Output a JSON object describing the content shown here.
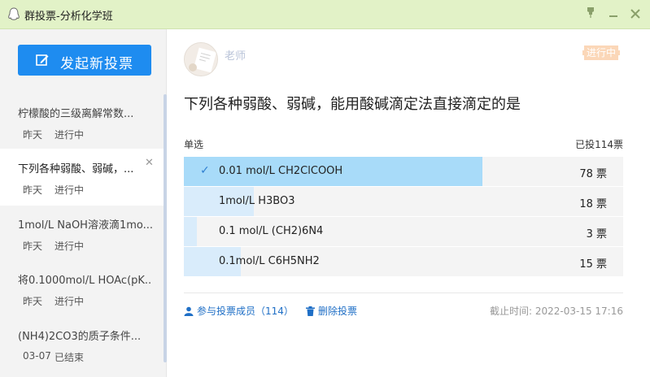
{
  "window": {
    "title": "群投票-分析化学班",
    "buttons": {
      "pin": "pin-icon",
      "minimize": "minimize-icon",
      "close": "close-icon"
    }
  },
  "sidebar": {
    "new_vote_label": "发起新投票",
    "items": [
      {
        "title": "柠檬酸的三级离解常数...",
        "date": "昨天",
        "status": "进行中"
      },
      {
        "title": "下列各种弱酸、弱碱，...",
        "date": "昨天",
        "status": "进行中"
      },
      {
        "title": "1mol/L NaOH溶液滴1mo...",
        "date": "昨天",
        "status": "进行中"
      },
      {
        "title": "将0.1000mol/L HOAc(pK...",
        "date": "昨天",
        "status": "进行中"
      },
      {
        "title": "(NH4)2CO3的质子条件...",
        "date": "03-07",
        "status": "已结束"
      }
    ]
  },
  "main": {
    "author": "老师",
    "status_tag": "进行中",
    "question": "下列各种弱酸、弱碱，能用酸碱滴定法直接滴定的是",
    "vote_type": "单选",
    "total": "已投114票",
    "options": [
      {
        "text": "0.01 mol/L CH2ClCOOH",
        "count": "78 票",
        "ratio": 0.68,
        "chosen": true
      },
      {
        "text": "1mol/L H3BO3",
        "count": "18 票",
        "ratio": 0.16,
        "chosen": false
      },
      {
        "text": "0.1 mol/L (CH2)6N4",
        "count": "3 票",
        "ratio": 0.03,
        "chosen": false
      },
      {
        "text": "0.1mol/L C6H5NH2",
        "count": "15 票",
        "ratio": 0.13,
        "chosen": false
      }
    ],
    "members_link": "参与投票成员（114）",
    "delete_link": "删除投票",
    "deadline": "截止时间:  2022-03-15 17:16"
  },
  "colors": {
    "accent": "#1e8cf0",
    "titlebar": "#e2f2c7",
    "chosen_fill": "#a8dbf9",
    "fill": "#d9ecfb",
    "status_tag": "#fbd7b8"
  }
}
